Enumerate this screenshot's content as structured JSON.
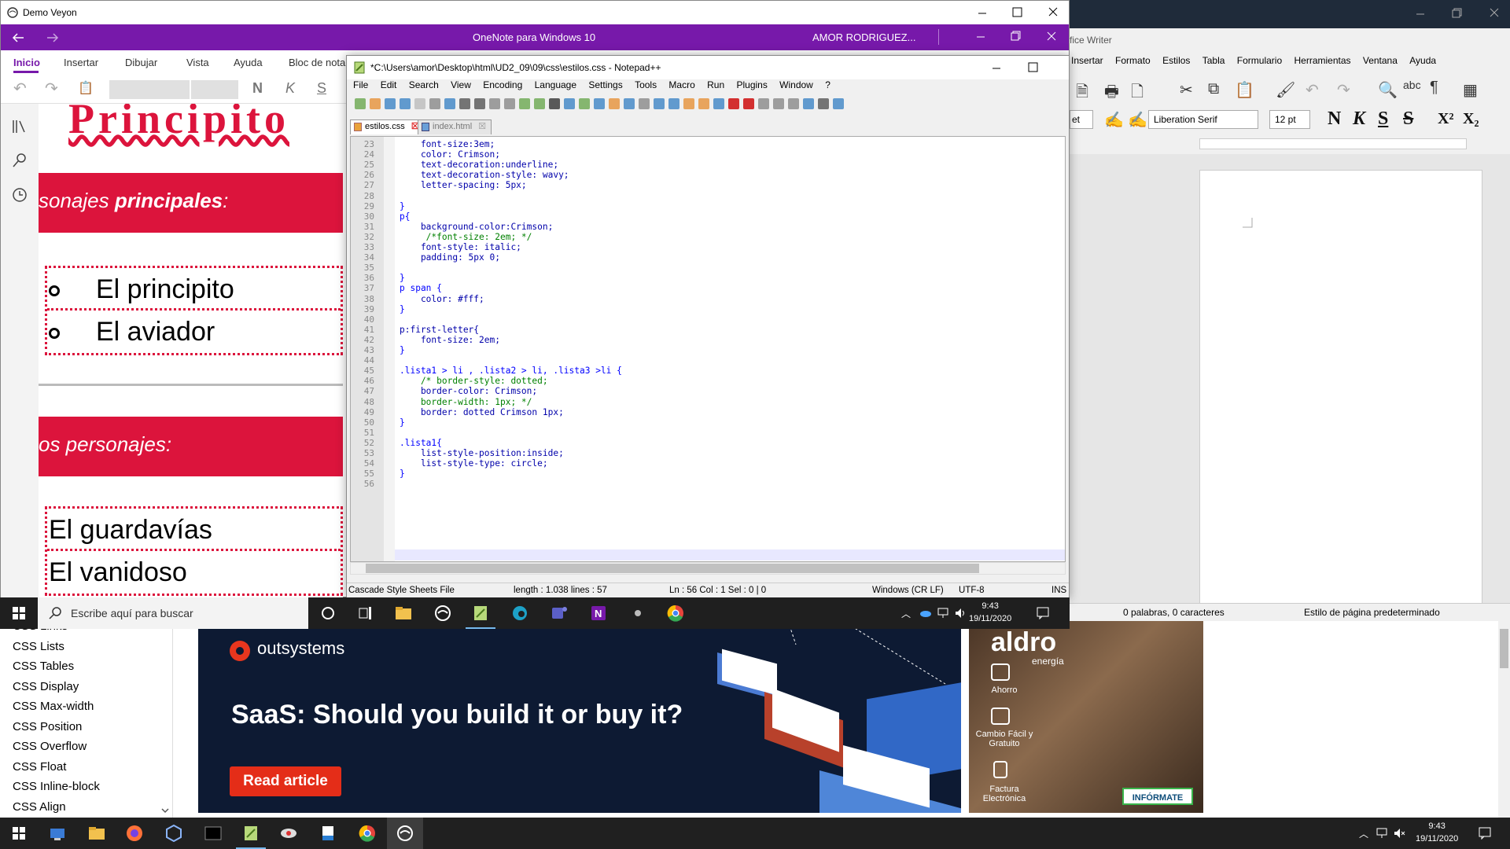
{
  "browser_sidebar": {
    "links": [
      "CSS Links",
      "CSS Lists",
      "CSS Tables",
      "CSS Display",
      "CSS Max-width",
      "CSS Position",
      "CSS Overflow",
      "CSS Float",
      "CSS Inline-block",
      "CSS Align"
    ]
  },
  "ad_outsystems": {
    "brand": "outsystems",
    "headline": "SaaS: Should you build it or buy it?",
    "button": "Read article"
  },
  "ad_aldro": {
    "brand": "aldro",
    "sub": "energía",
    "features": [
      "Ahorro",
      "Cambio Fácil y Gratuito",
      "Factura Electrónica"
    ],
    "button": "INFÓRMATE"
  },
  "writer": {
    "title": "fice Writer",
    "menu": [
      "Insertar",
      "Formato",
      "Estilos",
      "Tabla",
      "Formulario",
      "Herramientas",
      "Ventana",
      "Ayuda"
    ],
    "style_box": "et",
    "font": "Liberation Serif",
    "size": "12 pt",
    "format_buttons": [
      "N",
      "K",
      "S",
      "S",
      "X²",
      "X₂"
    ],
    "status_words": "0 palabras, 0 caracteres",
    "status_style": "Estilo de página predeterminado"
  },
  "onenote": {
    "app_title": "Demo Veyon",
    "window_title": "OneNote para Windows 10",
    "user": "AMOR RODRIGUEZ...",
    "tabs": [
      "Inicio",
      "Insertar",
      "Dibujar",
      "Vista",
      "Ayuda",
      "Bloc de nota"
    ],
    "ribbon_format": [
      "N",
      "K",
      "S"
    ],
    "page": {
      "title": "Principito",
      "banner1": "sonajes principales:",
      "banner1_a": "sonajes ",
      "banner1_b": "principales",
      "banner1_c": ":",
      "list1": [
        "El principito",
        "El aviador"
      ],
      "banner2": "os personajes:",
      "list2": [
        "El guardavías",
        "El vanidoso"
      ]
    }
  },
  "notepadpp": {
    "title": "*C:\\Users\\amor\\Desktop\\html\\UD2_09\\09\\css\\estilos.css - Notepad++",
    "menu": [
      "File",
      "Edit",
      "Search",
      "View",
      "Encoding",
      "Language",
      "Settings",
      "Tools",
      "Macro",
      "Run",
      "Plugins",
      "Window",
      "?"
    ],
    "tabs": [
      "estilos.css",
      "index.html"
    ],
    "code_lines": [
      {
        "n": "23",
        "t": "    font-size:3em;"
      },
      {
        "n": "24",
        "t": "    color: Crimson;"
      },
      {
        "n": "25",
        "t": "    text-decoration:underline;"
      },
      {
        "n": "26",
        "t": "    text-decoration-style: wavy;"
      },
      {
        "n": "27",
        "t": "    letter-spacing: 5px;"
      },
      {
        "n": "28",
        "t": ""
      },
      {
        "n": "29",
        "t": "}"
      },
      {
        "n": "30",
        "t": "p{"
      },
      {
        "n": "31",
        "t": "    background-color:Crimson;"
      },
      {
        "n": "32",
        "t": "     /*font-size: 2em; */"
      },
      {
        "n": "33",
        "t": "    font-style: italic;"
      },
      {
        "n": "34",
        "t": "    padding: 5px 0;"
      },
      {
        "n": "35",
        "t": ""
      },
      {
        "n": "36",
        "t": "}"
      },
      {
        "n": "37",
        "t": "p span {"
      },
      {
        "n": "38",
        "t": "    color: #fff;"
      },
      {
        "n": "39",
        "t": "}"
      },
      {
        "n": "40",
        "t": ""
      },
      {
        "n": "41",
        "t": "p:first-letter{"
      },
      {
        "n": "42",
        "t": "    font-size: 2em;"
      },
      {
        "n": "43",
        "t": "}"
      },
      {
        "n": "44",
        "t": ""
      },
      {
        "n": "45",
        "t": ".lista1 > li , .lista2 > li, .lista3 >li {"
      },
      {
        "n": "46",
        "t": "    /* border-style: dotted;"
      },
      {
        "n": "47",
        "t": "    border-color: Crimson;"
      },
      {
        "n": "48",
        "t": "    border-width: 1px; */"
      },
      {
        "n": "49",
        "t": "    border: dotted Crimson 1px;"
      },
      {
        "n": "50",
        "t": "}"
      },
      {
        "n": "51",
        "t": ""
      },
      {
        "n": "52",
        "t": ".lista1{"
      },
      {
        "n": "53",
        "t": "    list-style-position:inside;"
      },
      {
        "n": "54",
        "t": "    list-style-type: circle;"
      },
      {
        "n": "55",
        "t": "}"
      },
      {
        "n": "56",
        "t": ""
      }
    ],
    "status": {
      "lang": "Cascade Style Sheets File",
      "length": "length : 1.038    lines : 57",
      "pos": "Ln : 56    Col : 1    Sel : 0 | 0",
      "eol": "Windows (CR LF)",
      "enc": "UTF-8",
      "mode": "INS"
    }
  },
  "inner_taskbar": {
    "search_placeholder": "Escribe aquí para buscar",
    "time": "9:43",
    "date": "19/11/2020"
  },
  "outer_taskbar": {
    "time": "9:43",
    "date": "19/11/2020"
  },
  "colors": {
    "crimson": "#dc143c",
    "onenote_purple": "#7719aa",
    "outsystems_red": "#e42d18"
  }
}
